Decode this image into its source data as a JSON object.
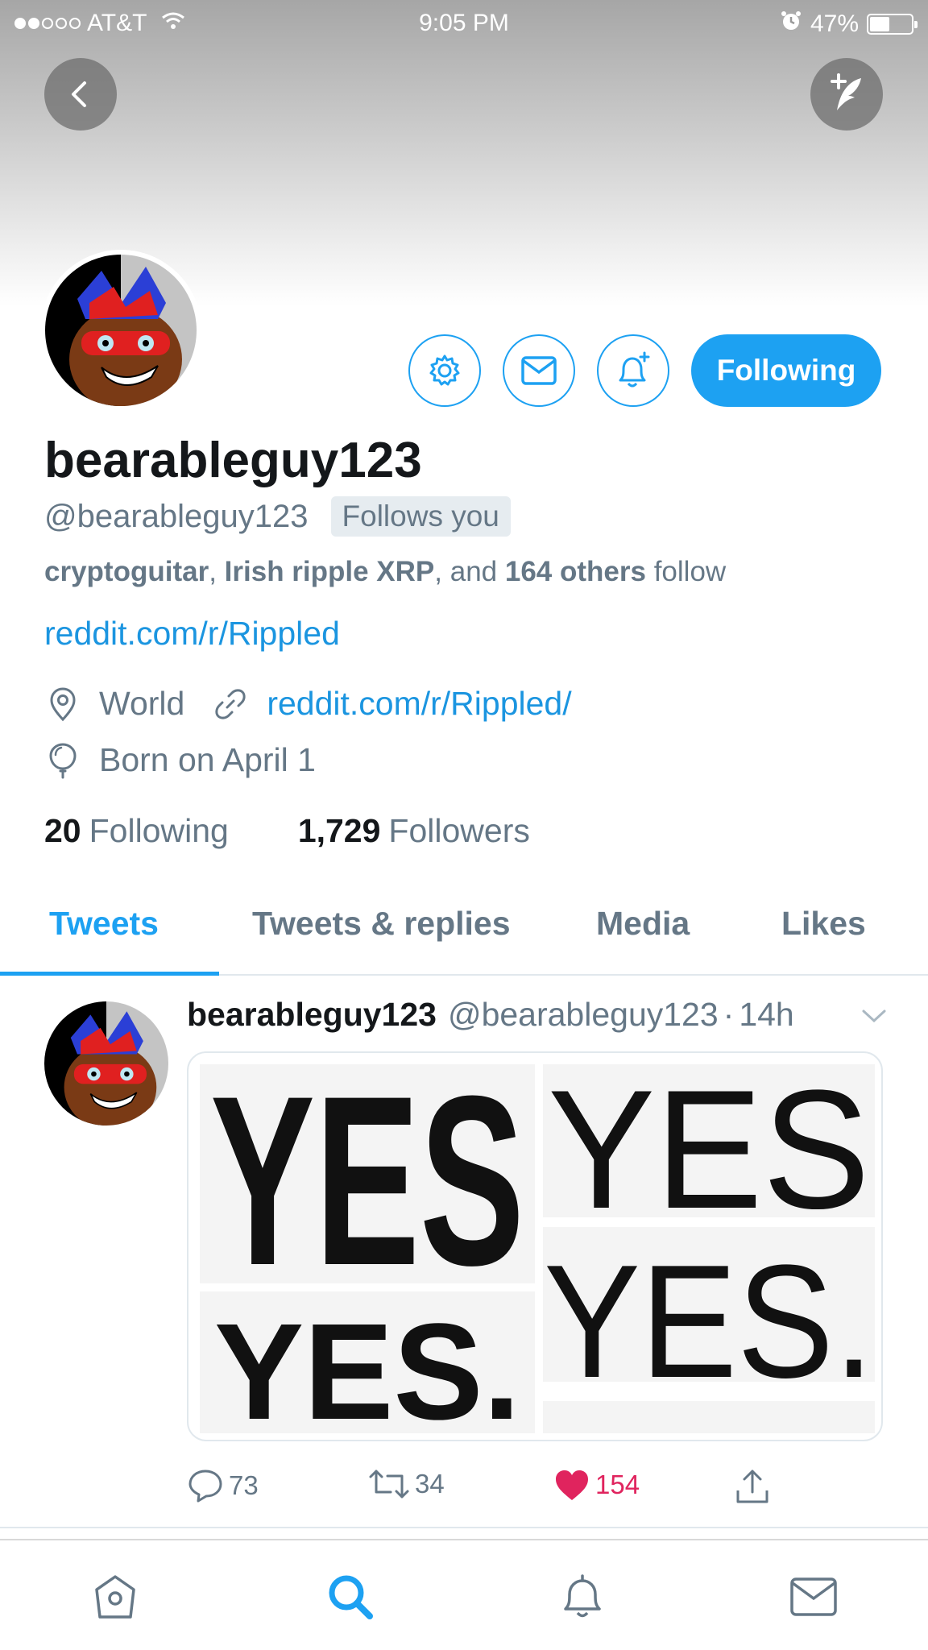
{
  "status_bar": {
    "carrier": "AT&T",
    "time": "9:05 PM",
    "battery": "47%",
    "battery_level": 0.47
  },
  "profile": {
    "display_name": "bearableguy123",
    "handle": "@bearableguy123",
    "follows_you": "Follows you",
    "followed_by": {
      "name1": "cryptoguitar",
      "name2": "Irish ripple XRP",
      "and_text": ", and",
      "others": "164 others",
      "follow_text": "follow"
    },
    "bio_link": "reddit.com/r/Rippled",
    "location": "World",
    "website": "reddit.com/r/Rippled/",
    "birthday": "Born on April 1",
    "following_count": "20",
    "following_label": "Following",
    "followers_count": "1,729",
    "followers_label": "Followers"
  },
  "actions": {
    "following_button": "Following"
  },
  "tabs": [
    "Tweets",
    "Tweets & replies",
    "Media",
    "Likes"
  ],
  "tweet": {
    "name": "bearableguy123",
    "handle": "@bearableguy123",
    "separator": "·",
    "time": "14h",
    "media_text": [
      "YES",
      "YES",
      "YES.",
      "YES."
    ],
    "replies": "73",
    "retweets": "34",
    "likes": "154"
  },
  "colors": {
    "accent": "#1da1f2",
    "link": "#1b95e0",
    "like": "#e0245e",
    "muted": "#657786"
  },
  "icons": {
    "back": "chevron-left-icon",
    "compose": "compose-feather-icon",
    "settings": "gear-icon",
    "message": "envelope-icon",
    "notify": "bell-plus-icon",
    "location": "location-pin-icon",
    "website": "link-icon",
    "birthday": "balloon-icon",
    "home": "home-icon",
    "search": "search-icon",
    "notifications": "bell-icon",
    "messages": "envelope-icon"
  }
}
